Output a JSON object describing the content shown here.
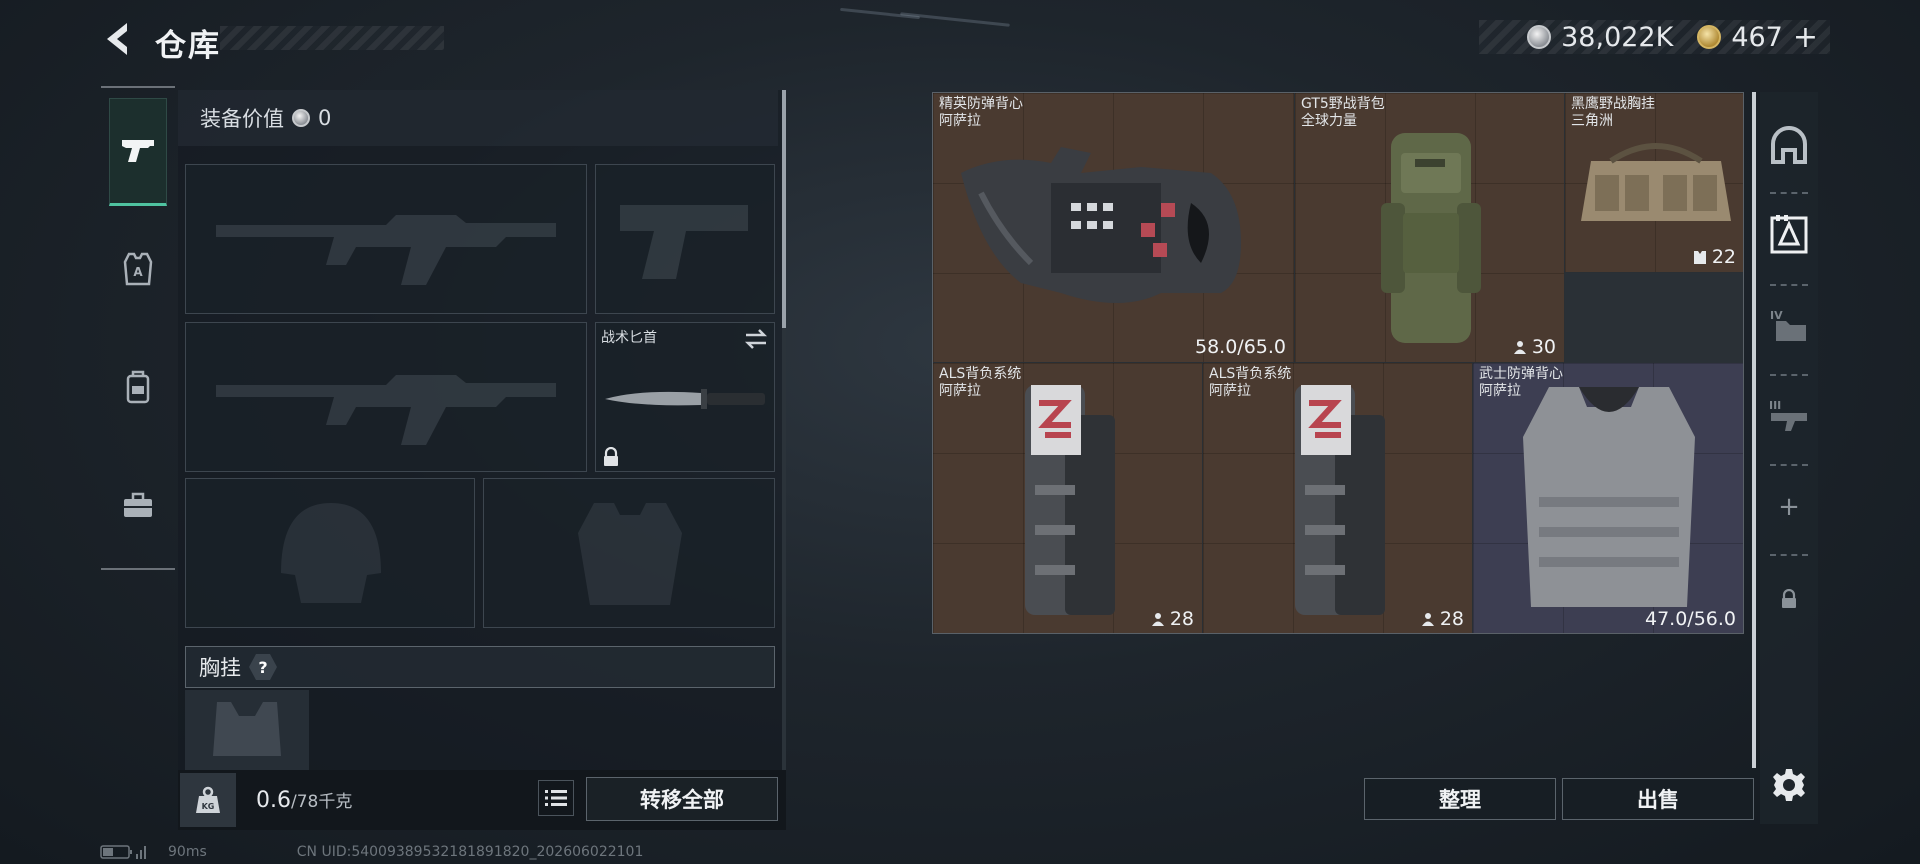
{
  "header": {
    "title": "仓库"
  },
  "currency": {
    "silver": "38,022K",
    "gold": "467",
    "gold_add": "+"
  },
  "side_tabs": [
    {
      "name": "weapon",
      "icon": "pistol-icon",
      "active": true
    },
    {
      "name": "armor",
      "icon": "armor-icon"
    },
    {
      "name": "backpack",
      "icon": "backpack-icon"
    },
    {
      "name": "case",
      "icon": "briefcase-icon"
    }
  ],
  "loadout": {
    "equip_value_label": "装备价值",
    "equip_value": "0",
    "melee_label": "战术匕首",
    "chest_rig_label": "胸挂",
    "help": "?",
    "weight": "0.6",
    "weight_max": "/78千克",
    "transfer_all": "转移全部"
  },
  "storage": {
    "items": [
      {
        "name": "精英防弹背心",
        "brand": "阿萨拉",
        "stat": "58.0/65.0"
      },
      {
        "name": "GT5野战背包",
        "brand": "全球力量",
        "stat": "30"
      },
      {
        "name": "黑鹰野战胸挂",
        "brand": "三角洲",
        "stat": "22"
      },
      {
        "name": "ALS背负系统",
        "brand": "阿萨拉",
        "stat": "28"
      },
      {
        "name": "ALS背负系统",
        "brand": "阿萨拉",
        "stat": "28"
      },
      {
        "name": "武士防弹背心",
        "brand": "阿萨拉",
        "stat": "47.0/56.0"
      }
    ],
    "sort": "整理",
    "sell": "出售"
  },
  "categories": [
    {
      "icon": "helmet-category-icon"
    },
    {
      "icon": "armor-category-icon",
      "active": true
    },
    {
      "icon": "folder-iv-icon",
      "tier": "IV"
    },
    {
      "icon": "gun-iii-icon",
      "tier": "III"
    },
    {
      "icon": "plus-icon",
      "glyph": "+"
    },
    {
      "icon": "lock-icon"
    }
  ],
  "footer": {
    "ping": "90ms",
    "uid": "CN UID:540093895321818918​20_202606022101"
  }
}
